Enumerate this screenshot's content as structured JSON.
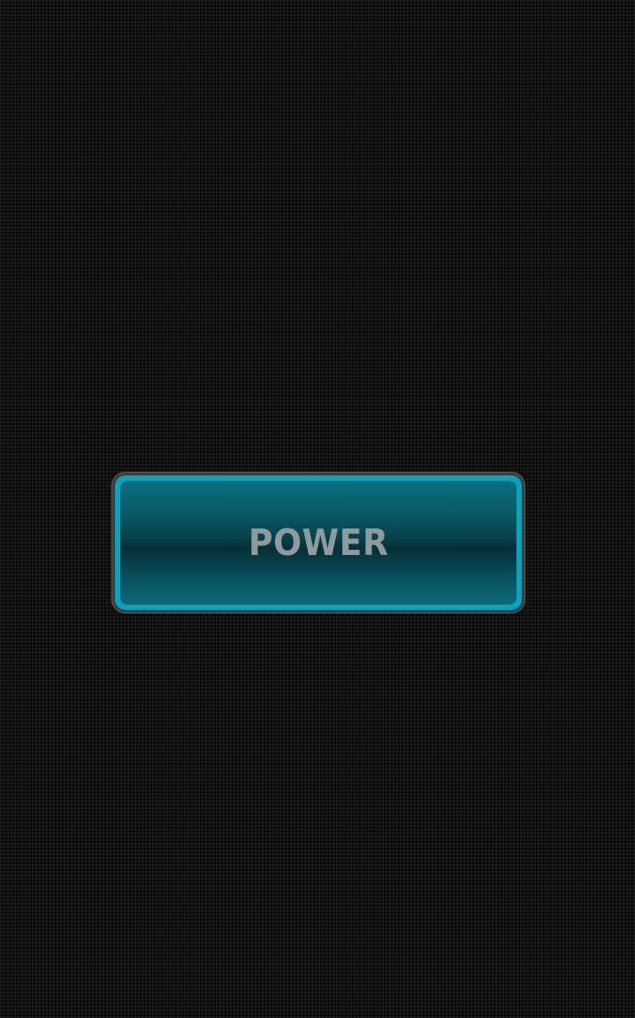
{
  "power_button": {
    "label": "POWER"
  },
  "colors": {
    "background": "#121212",
    "button_rim": "#0aa3bd",
    "button_face": "#07434d",
    "label_text": "#8f9a9c"
  }
}
